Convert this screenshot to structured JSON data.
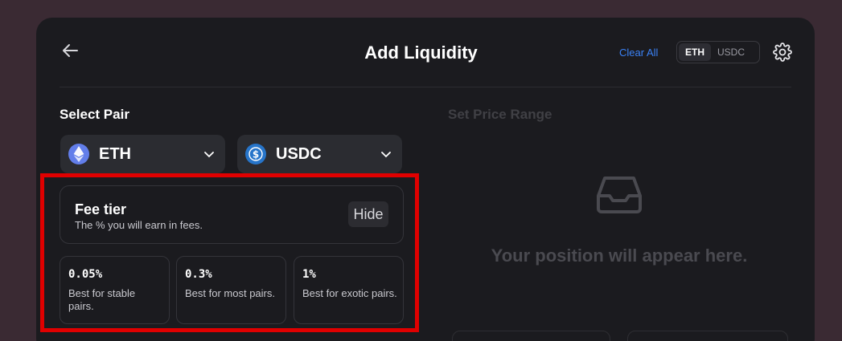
{
  "header": {
    "title": "Add Liquidity",
    "clear_all": "Clear All",
    "token_toggle": [
      "ETH",
      "USDC"
    ],
    "active_toggle": "ETH"
  },
  "select_pair": {
    "label": "Select Pair",
    "token_a": {
      "symbol": "ETH",
      "icon": "ethereum-icon"
    },
    "token_b": {
      "symbol": "USDC",
      "icon": "usdc-icon"
    }
  },
  "fee": {
    "title": "Fee tier",
    "subtitle": "The % you will earn in fees.",
    "hide_label": "Hide",
    "tiers": [
      {
        "value": "0.05%",
        "desc": "Best for stable pairs."
      },
      {
        "value": "0.3%",
        "desc": "Best for most pairs."
      },
      {
        "value": "1%",
        "desc": "Best for exotic pairs."
      }
    ]
  },
  "price_range": {
    "label": "Set Price Range",
    "empty_message": "Your position will appear here."
  },
  "colors": {
    "accent": "#3b82f6",
    "highlight": "#e00000",
    "card_bg": "#1b1b1f"
  }
}
